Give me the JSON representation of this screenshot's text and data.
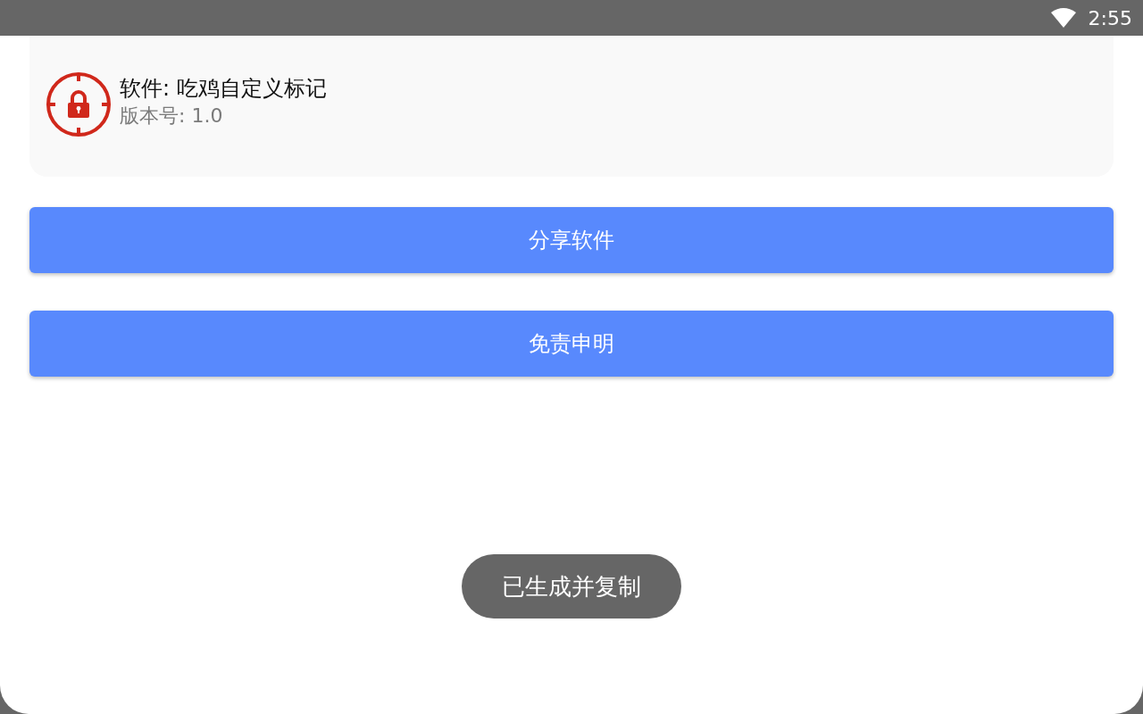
{
  "status_bar": {
    "time": "2:55"
  },
  "app_info": {
    "name_line": "软件: 吃鸡自定义标记",
    "version_line": "版本号: 1.0"
  },
  "buttons": [
    "分享软件",
    "免责申明"
  ],
  "toast": {
    "text": "已生成并复制"
  }
}
